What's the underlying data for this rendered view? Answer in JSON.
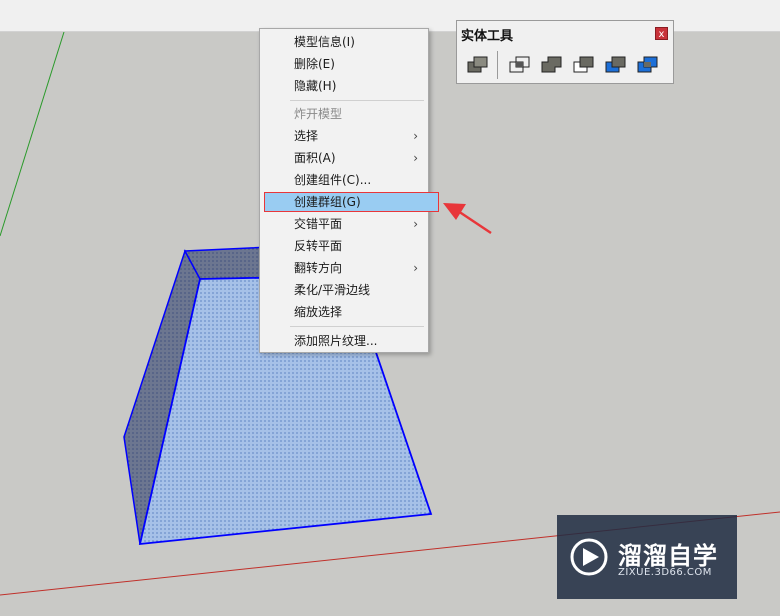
{
  "context_menu": {
    "items": [
      {
        "label": "模型信息(I)"
      },
      {
        "label": "删除(E)"
      },
      {
        "label": "隐藏(H)"
      },
      {
        "label": "炸开模型"
      },
      {
        "label": "选择"
      },
      {
        "label": "面积(A)"
      },
      {
        "label": "创建组件(C)..."
      },
      {
        "label": "创建群组(G)"
      },
      {
        "label": "交错平面"
      },
      {
        "label": "反转平面"
      },
      {
        "label": "翻转方向"
      },
      {
        "label": "柔化/平滑边线"
      },
      {
        "label": "缩放选择"
      },
      {
        "label": "添加照片纹理..."
      }
    ],
    "submenu_arrow": "›",
    "disabled_item": "炸开模型",
    "highlighted_item": "创建群组(G)"
  },
  "solid_tools": {
    "title": "实体工具",
    "close_label": "x",
    "buttons": [
      "outer-shell-icon",
      "intersect-icon",
      "union-icon",
      "subtract-icon",
      "trim-icon",
      "split-icon"
    ]
  },
  "watermark": {
    "title": "溜溜自学",
    "url": "ZIXUE.3D66.COM"
  },
  "colors": {
    "background": "#c9c9c6",
    "selected_edge": "#0000ff",
    "highlight": "#99ccf2",
    "annotation": "#e8363a",
    "red_axis": "#c0302a",
    "green_axis": "#2a9a2a"
  }
}
